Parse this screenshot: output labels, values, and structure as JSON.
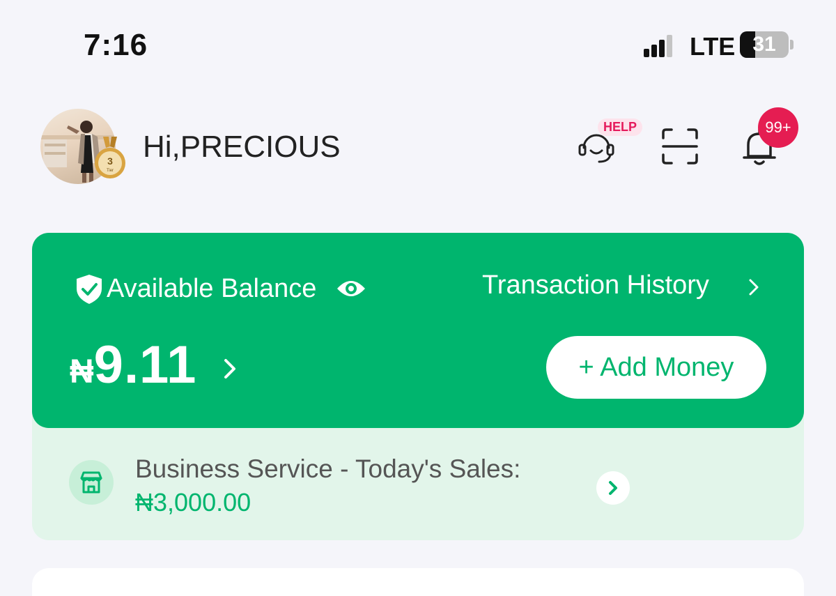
{
  "status_bar": {
    "time": "7:16",
    "network": "LTE",
    "battery_percent": "31",
    "battery_level": 0.31,
    "signal_bars": 3
  },
  "header": {
    "greeting": "Hi,PRECIOUS",
    "tier_badge": "3",
    "tier_badge_caption": "Tier",
    "help_tag": "HELP",
    "notification_count": "99+",
    "icons": [
      "customer-support-icon",
      "scan-icon",
      "bell-icon"
    ]
  },
  "balance_card": {
    "label": "Available Balance",
    "transaction_history": "Transaction History",
    "currency": "₦",
    "amount": "9.11",
    "add_money": "+ Add Money"
  },
  "business_service": {
    "label": "Business Service - Today's Sales:",
    "amount": "₦3,000.00"
  },
  "colors": {
    "brand_green": "#00b56e",
    "badge_red": "#e51d52",
    "help_pink": "#e5195b"
  }
}
